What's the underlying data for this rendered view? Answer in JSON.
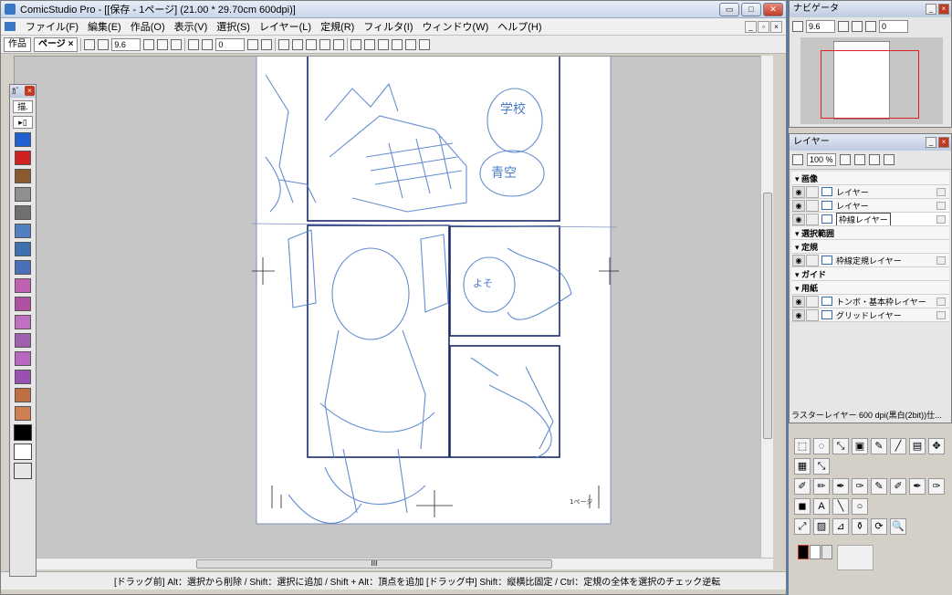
{
  "window": {
    "title": "ComicStudio Pro - [[保存 - 1ページ] (21.00 * 29.70cm 600dpi)]",
    "buttons": {
      "minimize": "▭",
      "maximize": "□",
      "close": "✕"
    }
  },
  "menu": {
    "items": [
      "ファイル(F)",
      "編集(E)",
      "作品(O)",
      "表示(V)",
      "選択(S)",
      "レイヤー(L)",
      "定規(R)",
      "フィルタ(I)",
      "ウィンドウ(W)",
      "ヘルプ(H)"
    ]
  },
  "toolbar": {
    "tabs": [
      "作品",
      "ページ ×"
    ],
    "zoom": "9.6",
    "angle": "0"
  },
  "left_palette": {
    "header": "ｶﾞ",
    "dropdown": "描.",
    "pen_colors": [
      "#2060d0",
      "#d02020",
      "#8a5a30",
      "#909090",
      "#707070",
      "#5080c0",
      "#4070b0",
      "#4a6fb8",
      "#c060b0",
      "#b050a0",
      "#c070c0",
      "#a060b0",
      "#b868c0",
      "#9a50b0",
      "#c07040",
      "#d08050"
    ],
    "swatches": [
      "#000000",
      "#ffffff",
      "#e6e6e6"
    ]
  },
  "statusbar": {
    "text": "[ドラッグ前] Alt：選択から削除 / Shift：選択に追加 / Shift + Alt：頂点を追加 [ドラッグ中] Shift：縦横比固定 / Ctrl：定規の全体を選択のチェック逆転"
  },
  "canvas": {
    "page_label": "1ページ",
    "sketch_texts": [
      "学校",
      "青空",
      "よそ"
    ]
  },
  "navigator": {
    "title": "ナビゲータ",
    "zoom": "9.6",
    "angle": "0"
  },
  "layers": {
    "title": "レイヤー",
    "opacity": "100 %",
    "rows": [
      {
        "label": "画像",
        "type": "group"
      },
      {
        "label": "レイヤー",
        "type": "layer"
      },
      {
        "label": "レイヤー",
        "type": "layer"
      },
      {
        "label": "枠線レイヤー",
        "type": "layer",
        "selected": true
      },
      {
        "label": "選択範囲",
        "type": "group"
      },
      {
        "label": "定規",
        "type": "group"
      },
      {
        "label": "枠線定規レイヤー",
        "type": "layer"
      },
      {
        "label": "ガイド",
        "type": "group"
      },
      {
        "label": "用紙",
        "type": "group"
      },
      {
        "label": "トンボ・基本枠レイヤー",
        "type": "layer"
      },
      {
        "label": "グリッドレイヤー",
        "type": "layer"
      }
    ],
    "footer": "ラスターレイヤー 600 dpi(黒白(2bit))仕..."
  },
  "tools_palette": {
    "rows": [
      [
        "⬚",
        "◌",
        "⤡",
        "▣",
        "✎",
        "╱",
        "▤",
        "✥"
      ],
      [
        "▦",
        "⤡"
      ],
      [
        "✐",
        "✏",
        "✒",
        "✑",
        "✎",
        "✐",
        "✒",
        "✑"
      ],
      [
        "◼",
        "A",
        "╲",
        "○"
      ],
      [
        "⤢",
        "▨",
        "⊿",
        "⚱",
        "⟳",
        "🔍"
      ]
    ]
  }
}
